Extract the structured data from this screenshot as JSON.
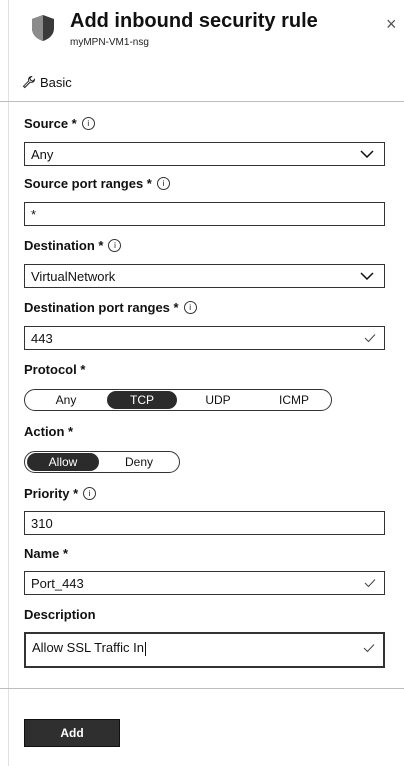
{
  "header": {
    "title": "Add inbound security rule",
    "subtitle": "myMPN-VM1-nsg",
    "close_glyph": "×",
    "icon": "shield-icon"
  },
  "tab": {
    "label": "Basic",
    "icon": "wrench-icon"
  },
  "form": {
    "source": {
      "label": "Source *",
      "value": "Any"
    },
    "source_ports": {
      "label": "Source port ranges *",
      "value": "*"
    },
    "destination": {
      "label": "Destination *",
      "value": "VirtualNetwork"
    },
    "destination_ports": {
      "label": "Destination port ranges *",
      "value": "443"
    },
    "protocol": {
      "label": "Protocol *",
      "options": [
        "Any",
        "TCP",
        "UDP",
        "ICMP"
      ],
      "selected": "TCP"
    },
    "action": {
      "label": "Action *",
      "options": [
        "Allow",
        "Deny"
      ],
      "selected": "Allow"
    },
    "priority": {
      "label": "Priority *",
      "value": "310"
    },
    "name": {
      "label": "Name *",
      "value": "Port_443"
    },
    "description": {
      "label": "Description",
      "value": "Allow SSL Traffic In"
    }
  },
  "info_glyph": "i",
  "footer": {
    "add_label": "Add"
  }
}
